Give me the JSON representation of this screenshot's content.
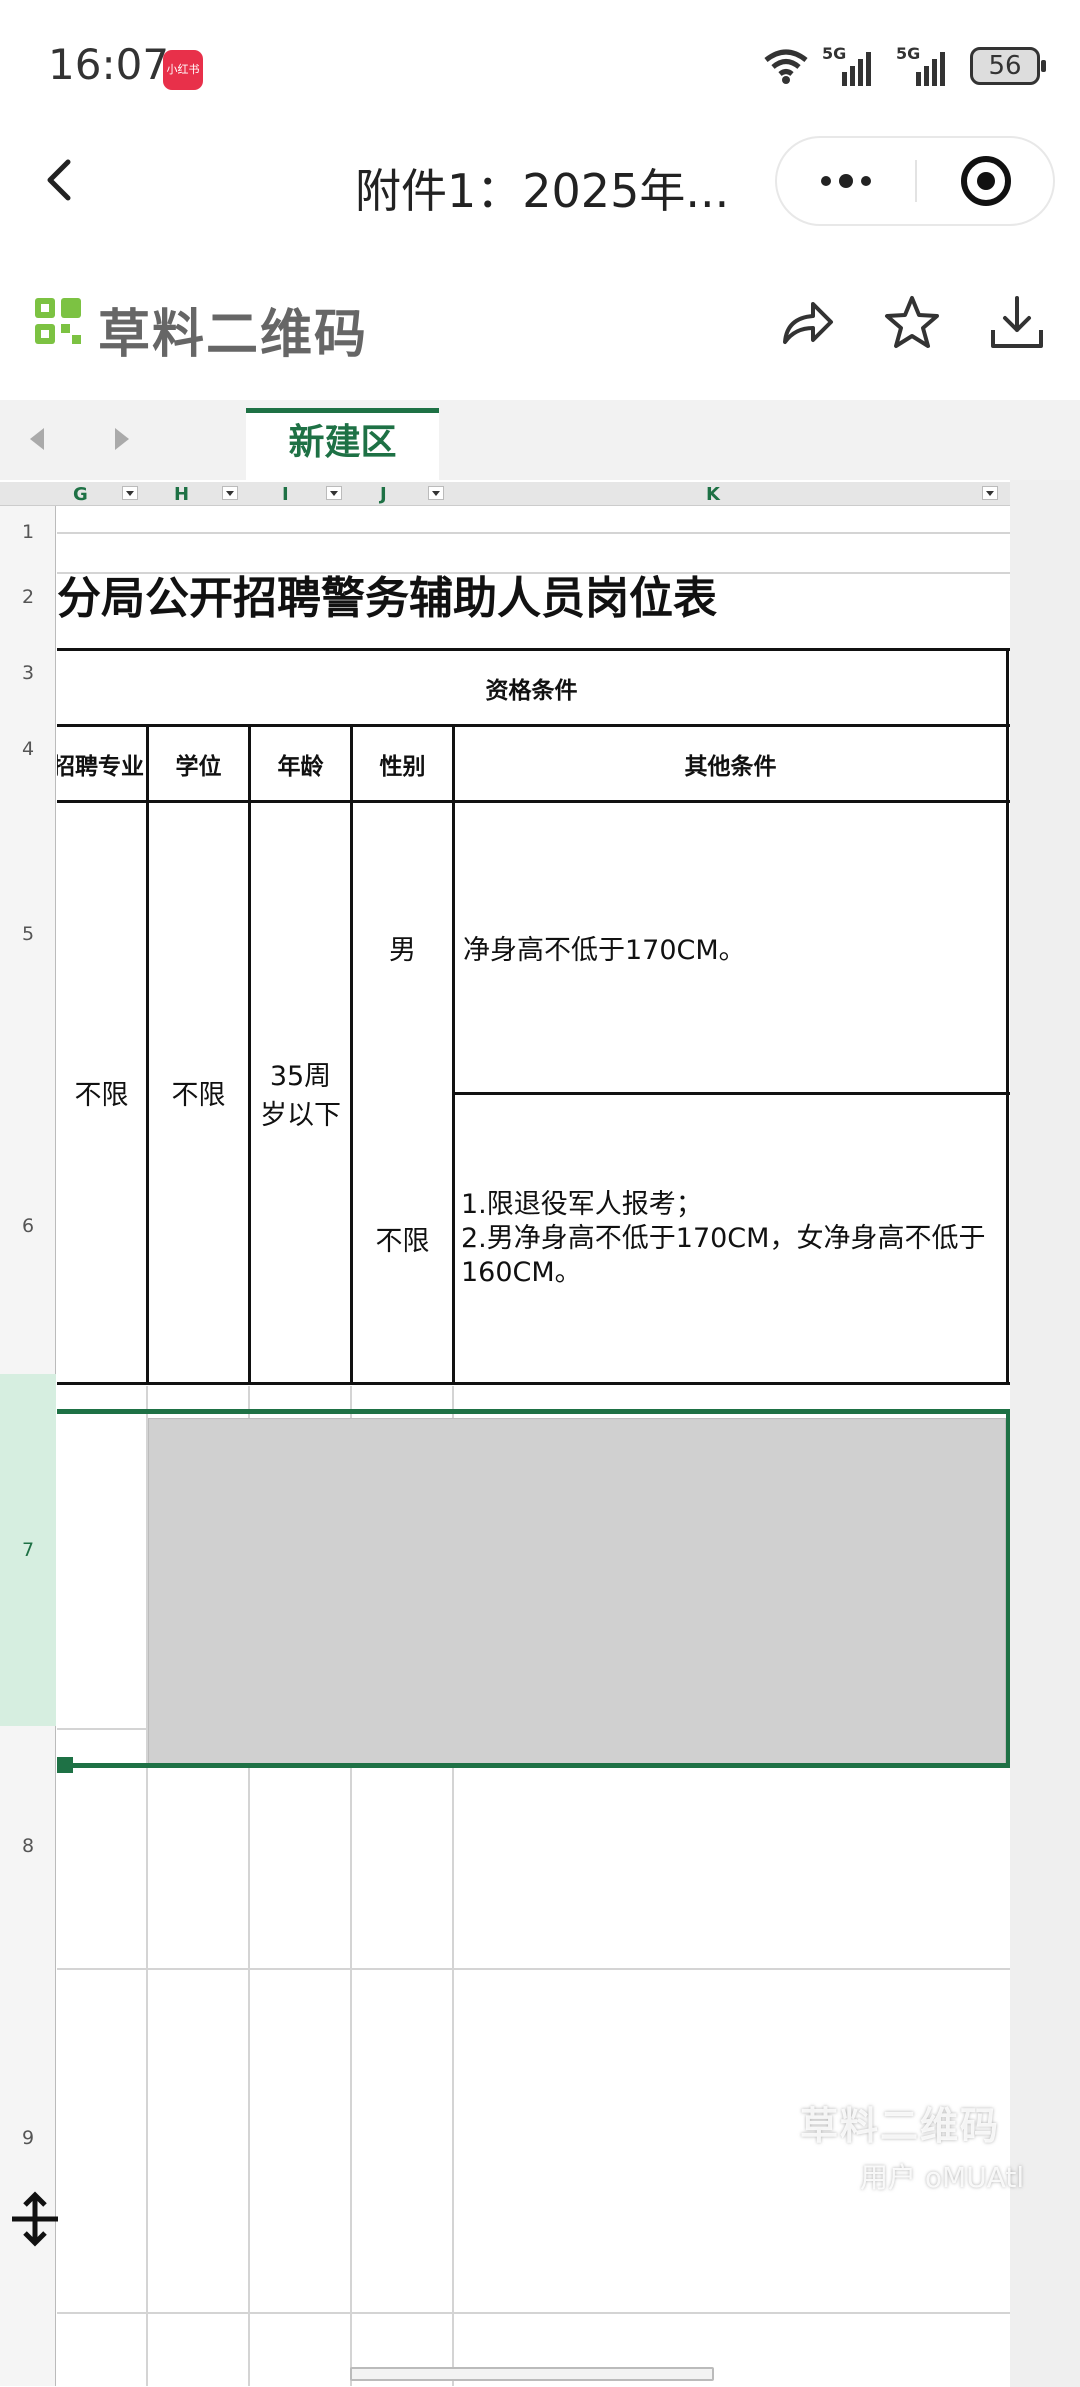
{
  "status_bar": {
    "time": "16:07",
    "app_badge": "小红书",
    "signal_1_label": "5G",
    "signal_2_label": "5G",
    "battery": "56"
  },
  "nav": {
    "title": "附件1：2025年..."
  },
  "brand": {
    "name": "草料二维码",
    "logo_color": "#7cc242",
    "actions": [
      "share-icon",
      "star-icon",
      "download-icon"
    ]
  },
  "tabs": {
    "active": "新建区"
  },
  "sheet": {
    "columns": [
      "G",
      "H",
      "I",
      "J",
      "K"
    ],
    "rows": [
      "1",
      "2",
      "3",
      "4",
      "5",
      "6",
      "7",
      "8",
      "9"
    ],
    "title": "分局公开招聘警务辅助人员岗位表",
    "group_header": "资格条件",
    "headers": [
      "招聘专业",
      "学位",
      "年龄",
      "性别",
      "其他条件"
    ],
    "major": "不限",
    "degree": "不限",
    "age": "35周岁以下",
    "gender_row5": "男",
    "other_row5": "净身高不低于170CM。",
    "gender_row6": "不限",
    "other_row6_line1": "1.限退役军人报考；",
    "other_row6_line2": "2.男净身高不低于170CM，女净身高不低于160CM。",
    "accent_color": "#1e7145"
  },
  "watermark": {
    "brand": "草料二维码",
    "user": "用户 oMUAtl"
  }
}
